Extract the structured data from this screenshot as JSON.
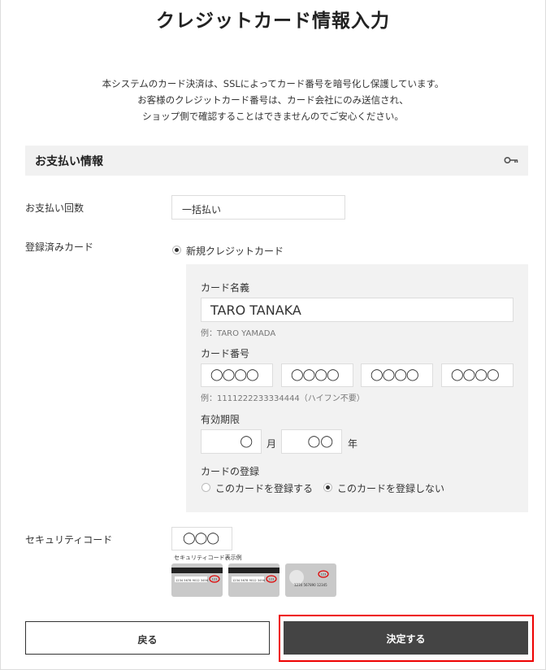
{
  "page": {
    "title": "クレジットカード情報入力",
    "notice_lines": [
      "本システムのカード決済は、SSLによってカード番号を暗号化し保護しています。",
      "お客様のクレジットカード番号は、カード会社にのみ送信され、",
      "ショップ側で確認することはできませんのでご安心ください。"
    ]
  },
  "section": {
    "title": "お支払い情報",
    "icon": "key-icon"
  },
  "payment_count": {
    "label": "お支払い回数",
    "value": "一括払い"
  },
  "registered_card": {
    "label": "登録済みカード",
    "option_label": "新規クレジットカード",
    "option_selected": true
  },
  "card_form": {
    "name_label": "カード名義",
    "name_value": "TARO TANAKA",
    "name_hint": "例：TARO YAMADA",
    "number_label": "カード番号",
    "number_parts": [
      "◯◯◯◯",
      "◯◯◯◯",
      "◯◯◯◯",
      "◯◯◯◯"
    ],
    "number_hint": "例：1111222233334444（ハイフン不要）",
    "expiry_label": "有効期限",
    "expiry_month": "◯",
    "month_unit": "月",
    "expiry_year": "◯◯",
    "year_unit": "年",
    "register_label": "カードの登録",
    "register_options": [
      {
        "label": "このカードを登録する",
        "selected": false
      },
      {
        "label": "このカードを登録しない",
        "selected": true
      }
    ]
  },
  "security_code": {
    "label": "セキュリティコード",
    "value": "◯◯◯",
    "caption": "セキュリティコード表示例",
    "samples": [
      "1234 5678 9012 3456",
      "1234 5678 9012 3456",
      "1234 567890 12345"
    ],
    "sample_code": "123"
  },
  "buttons": {
    "back": "戻る",
    "submit": "決定する"
  },
  "colors": {
    "submit_bg": "#444444",
    "highlight": "#ee0000",
    "section_bg": "#f1f1f1"
  }
}
